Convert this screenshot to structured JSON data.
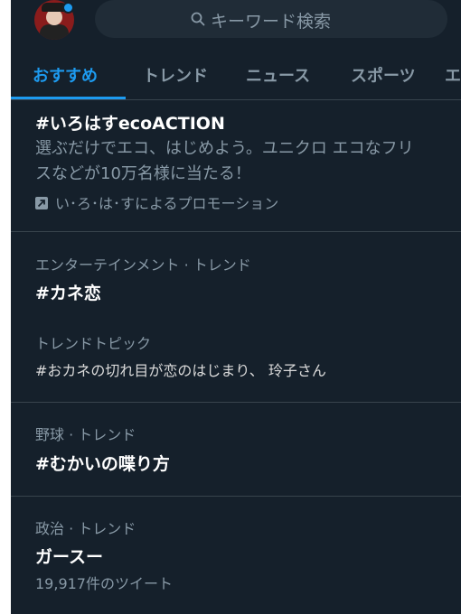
{
  "search": {
    "placeholder": "キーワード検索"
  },
  "tabs": [
    {
      "label": "おすすめ",
      "active": true
    },
    {
      "label": "トレンド"
    },
    {
      "label": "ニュース"
    },
    {
      "label": "スポーツ"
    },
    {
      "label": "エ"
    }
  ],
  "promoted": {
    "title": "#いろはすecoACTION",
    "desc_line1": "選ぶだけでエコ、はじめよう。ユニクロ エコなフリ",
    "desc_line2": "スなどが10万名様に当たる！",
    "promoter": "い･ろ･は･すによるプロモーション"
  },
  "trends": [
    {
      "meta": "エンターテインメント · トレンド",
      "title": "#カネ恋",
      "topic_label": "トレンドトピック",
      "topic_text": "#おカネの切れ目が恋のはじまり、 玲子さん"
    },
    {
      "meta": "野球 · トレンド",
      "title": "#むかいの喋り方"
    },
    {
      "meta": "政治 · トレンド",
      "title": "ガースー",
      "count": "19,917件のツイート"
    }
  ],
  "colors": {
    "accent": "#1d9bf0",
    "background": "#15202b",
    "muted": "#8899a6",
    "divider": "#38444d"
  }
}
